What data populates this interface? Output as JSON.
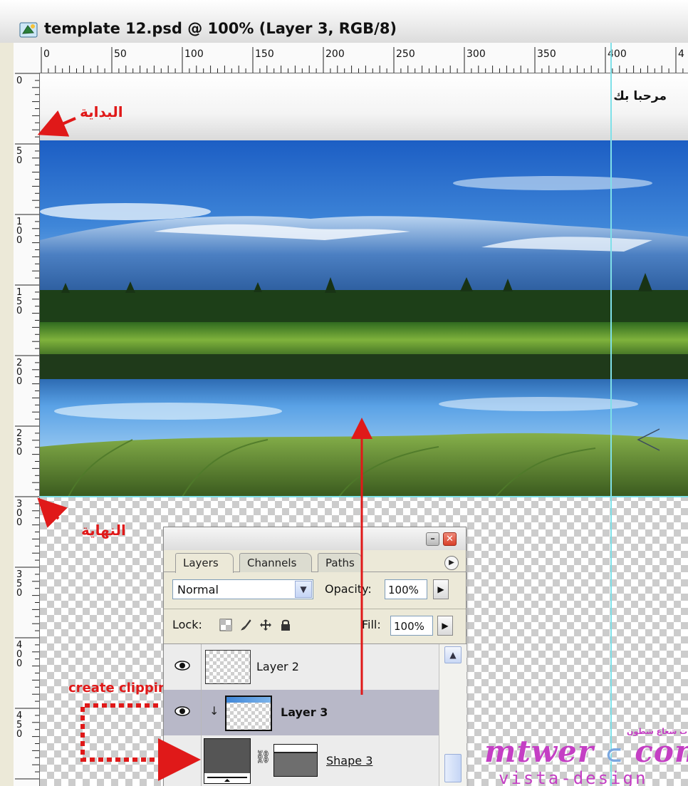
{
  "window": {
    "title": "template 12.psd @ 100% (Layer 3, RGB/8)"
  },
  "ruler": {
    "h_labels": [
      "0",
      "50",
      "100",
      "150",
      "200",
      "250",
      "300",
      "350",
      "400",
      "4"
    ],
    "v_labels": [
      "0",
      "5\n0",
      "1\n0\n0",
      "1\n5\n0",
      "2\n0\n0",
      "2\n5\n0",
      "3\n0\n0",
      "3\n5\n0",
      "4\n0\n0",
      "4\n5\n0"
    ]
  },
  "canvas": {
    "welcome_text": "مرحبا بك"
  },
  "annotations": {
    "start_label": "البداية",
    "end_label": "النهاية",
    "clip_label": "create clipping mask",
    "color": "#e01919"
  },
  "layers_panel": {
    "tabs": [
      "Layers",
      "Channels",
      "Paths"
    ],
    "blend_mode": "Normal",
    "opacity_label": "Opacity:",
    "opacity_value": "100%",
    "lock_label": "Lock:",
    "fill_label": "Fill:",
    "fill_value": "100%",
    "layers": [
      {
        "name": "Layer 2",
        "visible": true,
        "selected": false
      },
      {
        "name": "Layer 3",
        "visible": true,
        "selected": true,
        "clipped": true
      },
      {
        "name": "Shape 3",
        "visible": false,
        "selected": false,
        "has_mask": true
      }
    ]
  },
  "watermark": {
    "brand": "mtwer",
    "suffix": "com",
    "tagline": "vista-design",
    "arabic": "منتديات شعاع شطون"
  },
  "colors": {
    "guide": "#7fe0e8",
    "accent_red": "#e01919",
    "watermark": "#c43fc4"
  }
}
